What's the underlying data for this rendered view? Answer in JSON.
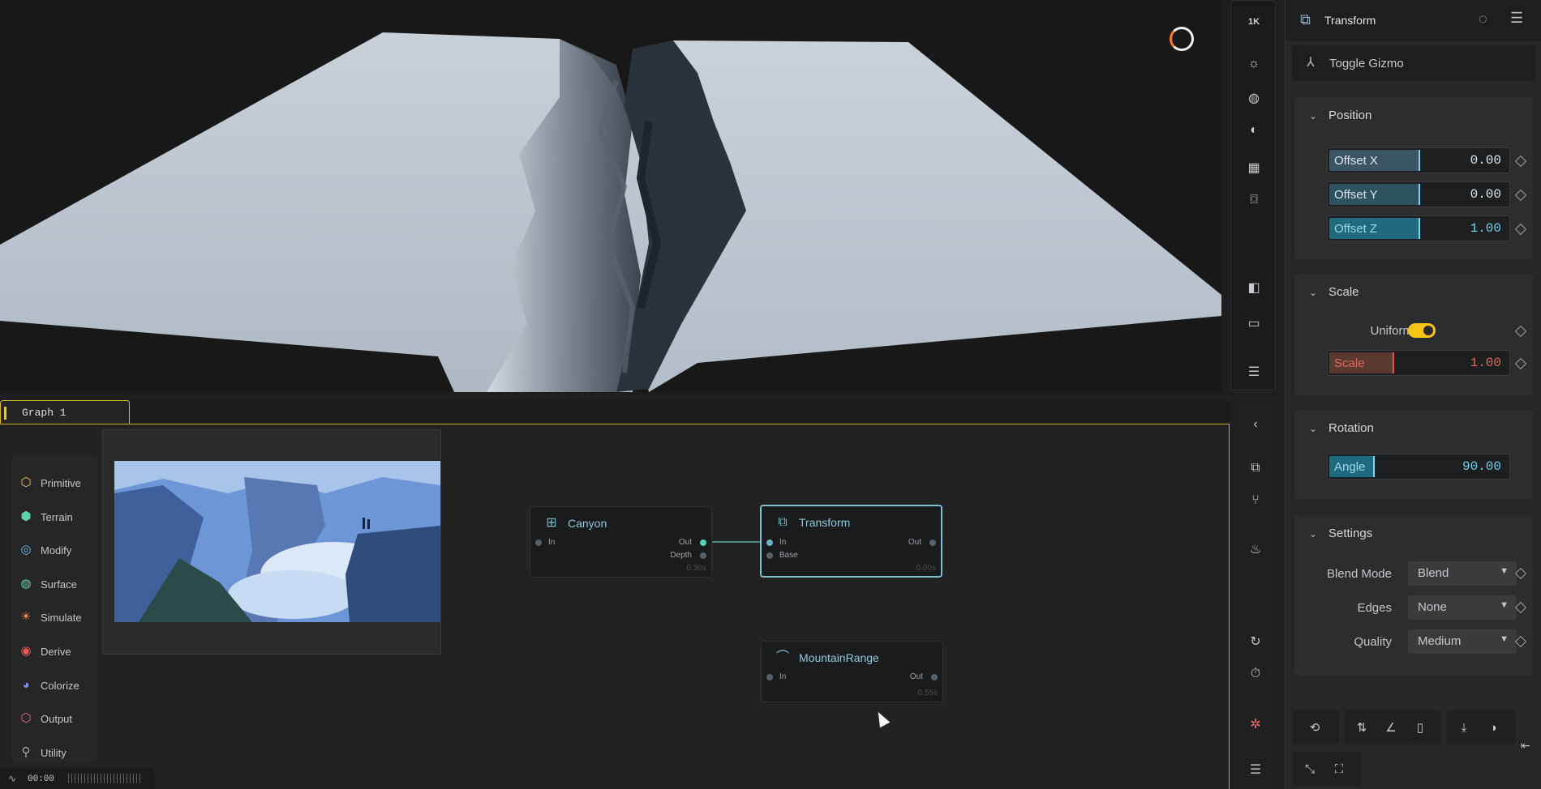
{
  "viewport": {
    "resolution_badge": "1K",
    "tools": [
      "sun-icon",
      "globe-icon",
      "contrast-icon",
      "grid-icon",
      "camera-icon",
      "compare-icon",
      "ruler-icon",
      "menu-icon"
    ]
  },
  "panel": {
    "title": "Transform",
    "gizmo_label": "Toggle Gizmo",
    "position": {
      "header": "Position",
      "fields": [
        {
          "label": "Offset X",
          "value": "0.00"
        },
        {
          "label": "Offset Y",
          "value": "0.00"
        },
        {
          "label": "Offset Z",
          "value": "1.00"
        }
      ]
    },
    "scale": {
      "header": "Scale",
      "uniform_label": "Uniform",
      "field": {
        "label": "Scale",
        "value": "1.00"
      }
    },
    "rotation": {
      "header": "Rotation",
      "field": {
        "label": "Angle",
        "value": "90.00"
      }
    },
    "settings": {
      "header": "Settings",
      "rows": [
        {
          "label": "Blend Mode",
          "value": "Blend"
        },
        {
          "label": "Edges",
          "value": "None"
        },
        {
          "label": "Quality",
          "value": "Medium"
        }
      ]
    }
  },
  "graph": {
    "tab_label": "Graph 1",
    "palette": [
      "Primitive",
      "Terrain",
      "Modify",
      "Surface",
      "Simulate",
      "Derive",
      "Colorize",
      "Output",
      "Utility"
    ],
    "nodes": {
      "canyon": {
        "title": "Canyon",
        "in": "In",
        "out": "Out",
        "depth": "Depth",
        "time": "0.30s"
      },
      "transform": {
        "title": "Transform",
        "in": "In",
        "out": "Out",
        "base": "Base",
        "time": "0.00s"
      },
      "mountain": {
        "title": "MountainRange",
        "in": "In",
        "out": "Out",
        "time": "0.55s"
      }
    },
    "status_time": "00:00"
  },
  "colors": {
    "accent": "#f5c518",
    "node_highlight": "#7fbcd6",
    "teal": "#53d3b8"
  }
}
